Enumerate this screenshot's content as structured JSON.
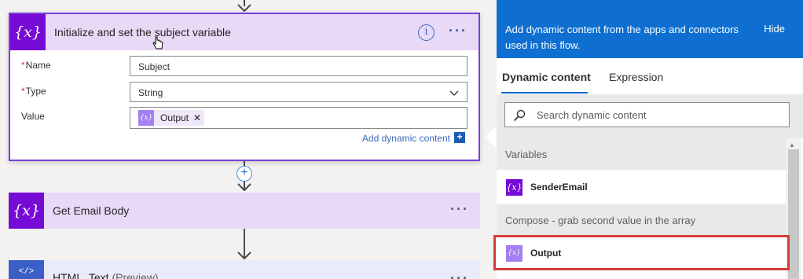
{
  "flow": {
    "init_step": {
      "title": "Initialize and set the subject variable",
      "icon": "variable-icon",
      "fields": {
        "name": {
          "label": "Name",
          "value": "Subject"
        },
        "type": {
          "label": "Type",
          "value": "String"
        },
        "value": {
          "label": "Value",
          "token": "Output"
        }
      },
      "add_dynamic_label": "Add dynamic content",
      "menu_label": "···"
    },
    "get_email_step": {
      "title": "Get Email Body",
      "menu_label": "···"
    },
    "html_text_step": {
      "title": "HTML_Text",
      "suffix": "(Preview)",
      "menu_label": "···"
    },
    "required_mark": "*",
    "insert_label": "+"
  },
  "panel": {
    "header_text": "Add dynamic content from the apps and connectors used in this flow.",
    "hide_label": "Hide",
    "tabs": [
      {
        "label": "Dynamic content",
        "active": true
      },
      {
        "label": "Expression",
        "active": false
      }
    ],
    "search_placeholder": "Search dynamic content",
    "sections": [
      {
        "title": "Variables",
        "items": [
          {
            "label": "SenderEmail",
            "color": "#770bd6"
          }
        ]
      },
      {
        "title": "Compose - grab second value in the array",
        "items": [
          {
            "label": "Output",
            "color": "#a47ef2",
            "highlighted": true
          }
        ]
      }
    ]
  },
  "colors": {
    "accent_blue": "#0e6fd1",
    "variable_purple": "#770bd6",
    "highlight_red": "#d83b3b"
  }
}
